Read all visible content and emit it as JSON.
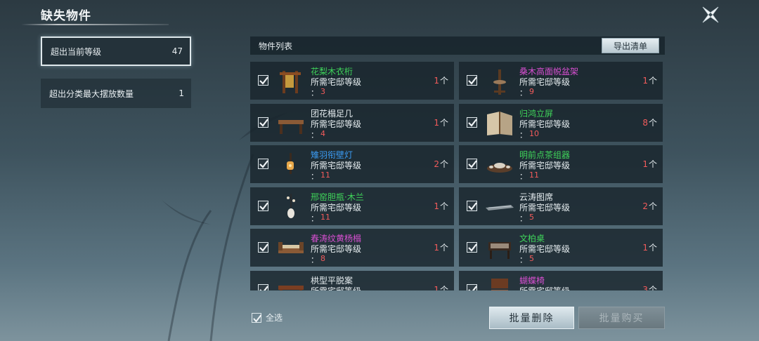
{
  "window": {
    "title": "缺失物件",
    "close_icon": "close-icon"
  },
  "categories": [
    {
      "label": "超出当前等级",
      "count": "47",
      "active": true
    },
    {
      "label": "超出分类最大摆放数量",
      "count": "1",
      "active": false
    }
  ],
  "list": {
    "title": "物件列表",
    "export_label": "导出清单",
    "req_label": "所需宅邸等级",
    "colon": "：",
    "unit": "个",
    "items": [
      {
        "name": "花梨木衣桁",
        "name_color": "#3fd35a",
        "level": "3",
        "qty": "1",
        "checked": true,
        "icon": "clothes-rack-icon"
      },
      {
        "name": "桑木高面帨盆架",
        "name_color": "#d64fd0",
        "level": "9",
        "qty": "1",
        "checked": true,
        "icon": "basin-stand-icon"
      },
      {
        "name": "团花榻足几",
        "name_color": "#e6edf0",
        "level": "4",
        "qty": "1",
        "checked": true,
        "icon": "low-table-icon"
      },
      {
        "name": "归鸿立屏",
        "name_color": "#3fd35a",
        "level": "10",
        "qty": "8",
        "checked": true,
        "icon": "screen-icon"
      },
      {
        "name": "雉羽衔壁灯",
        "name_color": "#3b9cf5",
        "level": "11",
        "qty": "2",
        "checked": true,
        "icon": "wall-lamp-icon"
      },
      {
        "name": "明前点茶组器",
        "name_color": "#3fd35a",
        "level": "11",
        "qty": "1",
        "checked": true,
        "icon": "tea-set-icon"
      },
      {
        "name": "邢窑胆瓶·木兰",
        "name_color": "#3fd35a",
        "level": "11",
        "qty": "1",
        "checked": true,
        "icon": "vase-icon"
      },
      {
        "name": "云涛图席",
        "name_color": "#e6edf0",
        "level": "5",
        "qty": "2",
        "checked": true,
        "icon": "mat-icon"
      },
      {
        "name": "春涛纹黄杨榻",
        "name_color": "#d64fd0",
        "level": "8",
        "qty": "1",
        "checked": true,
        "icon": "couch-icon"
      },
      {
        "name": "文柏桌",
        "name_color": "#3fd35a",
        "level": "5",
        "qty": "1",
        "checked": true,
        "icon": "desk-icon"
      },
      {
        "name": "栱型平脱案",
        "name_color": "#e6edf0",
        "level": "",
        "qty": "1",
        "checked": true,
        "icon": "table-icon"
      },
      {
        "name": "蝴蝶椅",
        "name_color": "#d64fd0",
        "level": "",
        "qty": "3",
        "checked": true,
        "icon": "chair-icon"
      }
    ]
  },
  "footer": {
    "select_all_label": "全选",
    "select_all_checked": true,
    "delete_label": "批量删除",
    "buy_label": "批量购买"
  }
}
